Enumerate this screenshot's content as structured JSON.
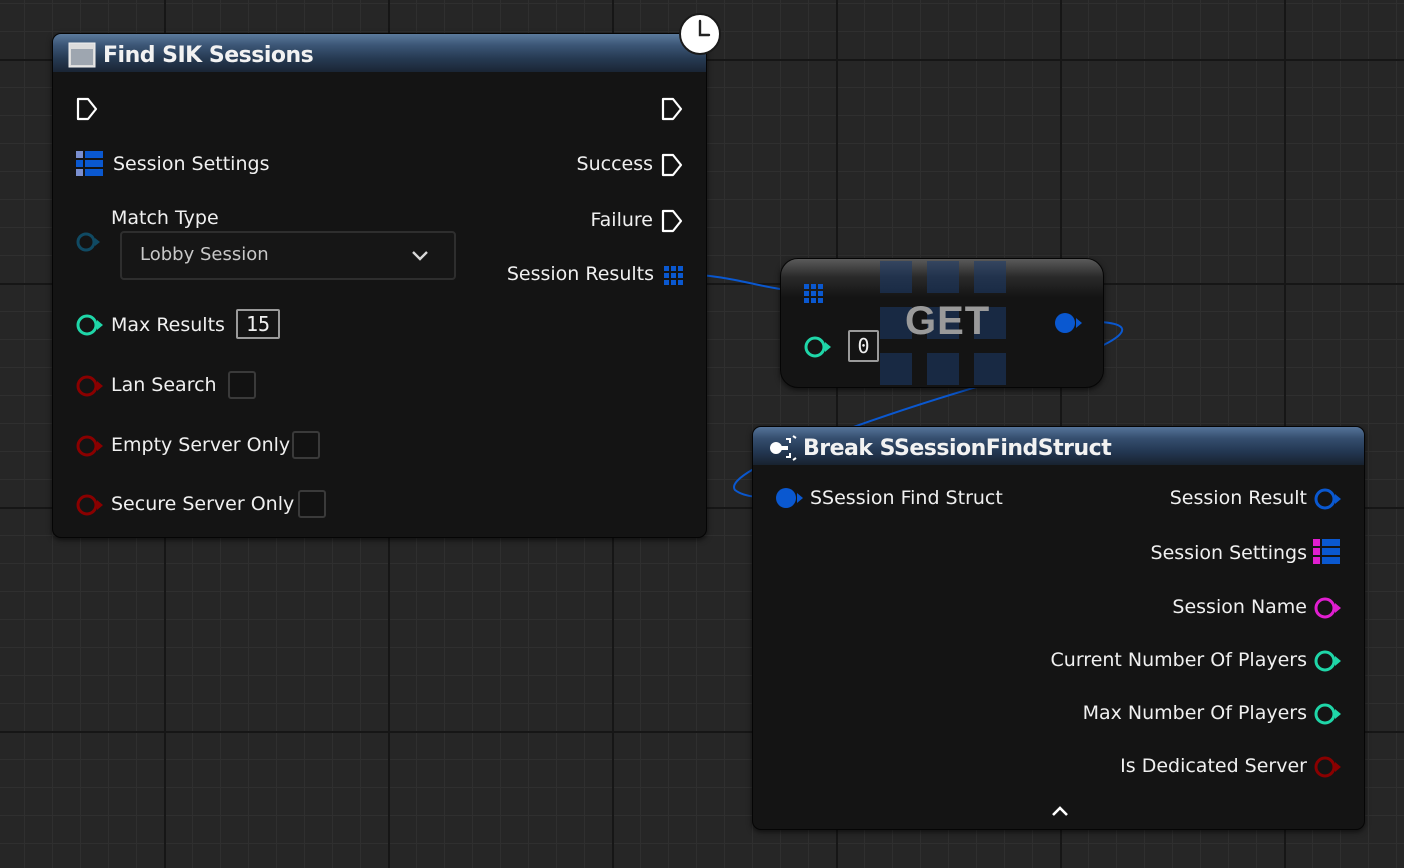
{
  "find_node": {
    "title": "Find SIK Sessions",
    "inputs": {
      "session_settings": "Session Settings",
      "match_type": "Match Type",
      "match_type_value": "Lobby Session",
      "max_results": "Max Results",
      "max_results_value": "15",
      "lan_search": "Lan Search",
      "empty_server_only": "Empty Server Only",
      "secure_server_only": "Secure Server Only"
    },
    "outputs": {
      "success": "Success",
      "failure": "Failure",
      "session_results": "Session Results"
    }
  },
  "get_node": {
    "title": "GET",
    "index_value": "0"
  },
  "break_node": {
    "title": "Break SSessionFindStruct",
    "input": "SSession Find Struct",
    "outputs": {
      "session_result": "Session Result",
      "session_settings": "Session Settings",
      "session_name": "Session Name",
      "current_players": "Current Number Of Players",
      "max_players": "Max Number Of Players",
      "is_dedicated": "Is Dedicated Server"
    }
  },
  "colors": {
    "exec_pin": "#ffffff",
    "struct_pin": "#0a58d0",
    "integer_pin": "#1fd6a8",
    "bool_pin": "#8a0000",
    "string_pin": "#e01ed0",
    "enum_pin": "#104a63",
    "wire": "#0a58d0",
    "header": "#2a3f5a"
  },
  "icons": [
    "clock-icon",
    "function-icon",
    "break-struct-icon",
    "struct-array-icon",
    "chevron-down-icon",
    "chevron-up-icon"
  ]
}
